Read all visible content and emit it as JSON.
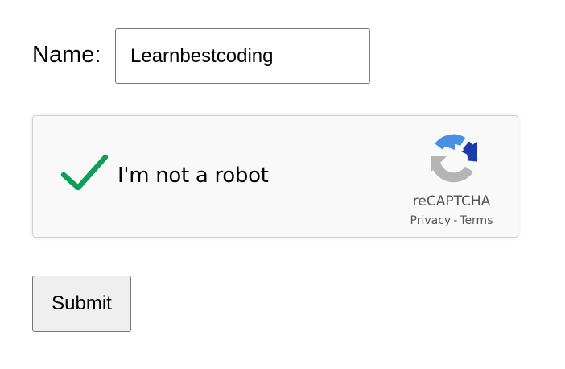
{
  "form": {
    "name_label": "Name:",
    "name_value": "Learnbestcoding"
  },
  "recaptcha": {
    "checkbox_label": "I'm not a robot",
    "checked": true,
    "brand": "reCAPTCHA",
    "privacy_label": "Privacy",
    "separator": "-",
    "terms_label": "Terms",
    "check_color": "#0f9d58",
    "logo_colors": {
      "blue_dark": "#1c3aa9",
      "blue_light": "#4a90e2",
      "gray": "#b5b5b5"
    },
    "icons": [
      "checkmark-icon",
      "recaptcha-logo-icon"
    ]
  },
  "actions": {
    "submit_label": "Submit"
  }
}
